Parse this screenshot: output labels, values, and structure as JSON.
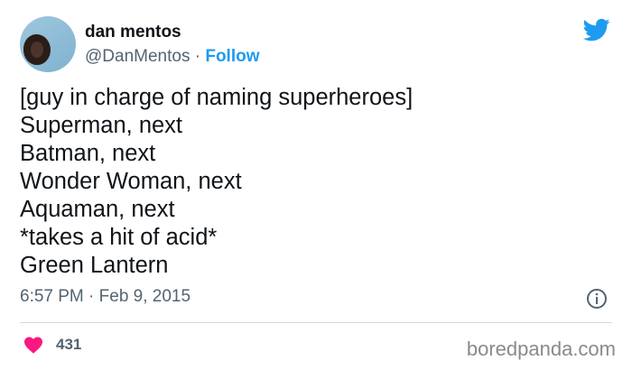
{
  "author": {
    "display_name": "dan mentos",
    "handle": "@DanMentos",
    "separator": " · ",
    "follow_label": "Follow"
  },
  "tweet": {
    "lines": [
      "[guy in charge of naming superheroes]",
      "Superman, next",
      "Batman, next",
      "Wonder Woman, next",
      "Aquaman, next",
      "*takes a hit of acid*",
      "Green Lantern"
    ],
    "timestamp": "6:57 PM · Feb 9, 2015",
    "like_count": "431"
  },
  "icons": {
    "brand": "twitter-bird-icon",
    "info": "info-icon",
    "like": "heart-icon"
  },
  "colors": {
    "accent": "#1d9bf0",
    "heart": "#f91880",
    "text": "#0f1419",
    "muted": "#536471"
  },
  "watermark": "boredpanda.com"
}
